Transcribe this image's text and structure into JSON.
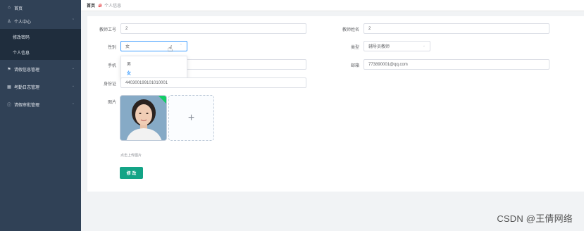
{
  "sidebar": {
    "home": "首页",
    "personal_center": "个人中心",
    "change_password": "修改密码",
    "personal_info": "个人信息",
    "leave_info_mgmt": "请假信息管理",
    "attendance_mgmt": "考勤日志管理",
    "leave_approval_mgmt": "请假审批管理"
  },
  "breadcrumb": {
    "home": "首页",
    "separator": "෧",
    "current": "个人信息"
  },
  "form": {
    "teacher_id_label": "教师工号",
    "teacher_id_value": "2",
    "teacher_name_label": "教师姓名",
    "teacher_name_value": "2",
    "gender_label": "性别",
    "gender_value": "女",
    "type_label": "类型",
    "type_value": "辅导员教师",
    "phone_label": "手机",
    "phone_value": "",
    "email_label": "邮箱",
    "email_value": "773890001@qq.com",
    "idcard_label": "身份证",
    "idcard_value": "440300199101010001",
    "photo_label": "图片",
    "upload_hint": "点击上传图片",
    "submit_label": "修 改"
  },
  "gender_options": [
    "男",
    "女"
  ],
  "watermark": "CSDN @王倩网络"
}
